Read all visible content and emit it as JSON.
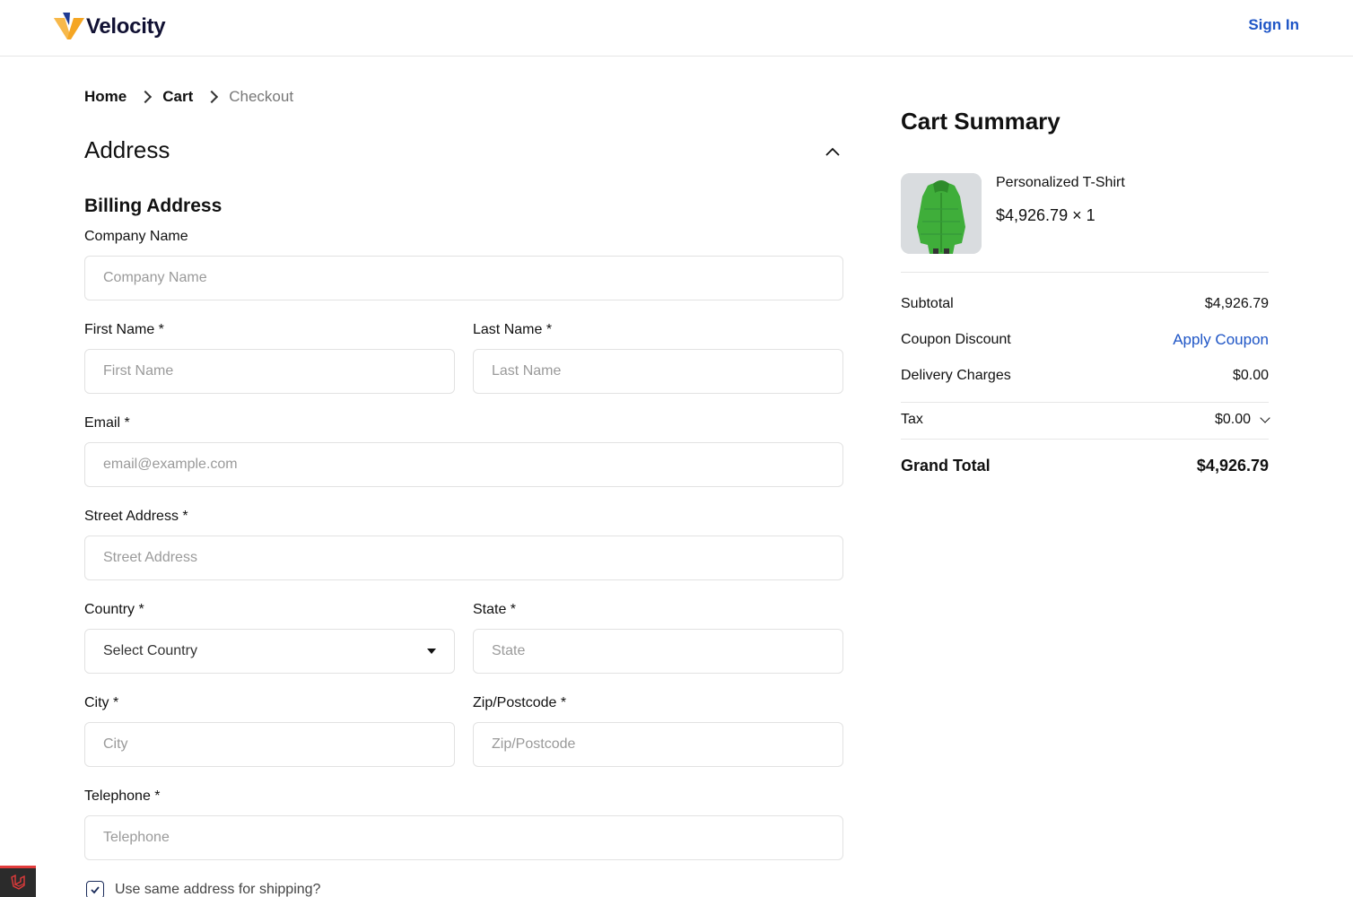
{
  "header": {
    "brand": "Velocity",
    "sign_in": "Sign In"
  },
  "breadcrumb": {
    "items": [
      "Home",
      "Cart"
    ],
    "current": "Checkout"
  },
  "address_section": {
    "title": "Address",
    "billing_title": "Billing Address",
    "fields": {
      "company": {
        "label": "Company Name",
        "placeholder": "Company Name"
      },
      "first_name": {
        "label": "First Name *",
        "placeholder": "First Name"
      },
      "last_name": {
        "label": "Last Name *",
        "placeholder": "Last Name"
      },
      "email": {
        "label": "Email *",
        "placeholder": "email@example.com"
      },
      "street": {
        "label": "Street Address *",
        "placeholder": "Street Address"
      },
      "country": {
        "label": "Country *",
        "value": "Select Country"
      },
      "state": {
        "label": "State *",
        "placeholder": "State"
      },
      "city": {
        "label": "City *",
        "placeholder": "City"
      },
      "zip": {
        "label": "Zip/Postcode *",
        "placeholder": "Zip/Postcode"
      },
      "telephone": {
        "label": "Telephone *",
        "placeholder": "Telephone"
      }
    },
    "same_address_label": "Use same address for shipping?",
    "same_address_checked": true
  },
  "cart_summary": {
    "title": "Cart Summary",
    "product": {
      "name": "Personalized T-Shirt",
      "price_qty": "$4,926.79 × 1",
      "image_color": "#3fae3a"
    },
    "subtotal_label": "Subtotal",
    "subtotal_value": "$4,926.79",
    "coupon_label": "Coupon Discount",
    "coupon_link": "Apply Coupon",
    "delivery_label": "Delivery Charges",
    "delivery_value": "$0.00",
    "tax_label": "Tax",
    "tax_value": "$0.00",
    "grand_total_label": "Grand Total",
    "grand_total_value": "$4,926.79"
  },
  "colors": {
    "accent": "#1e55c6",
    "brand_navy": "#111133",
    "logo_orange": "#f5a623",
    "logo_blue": "#3b5bdb"
  }
}
